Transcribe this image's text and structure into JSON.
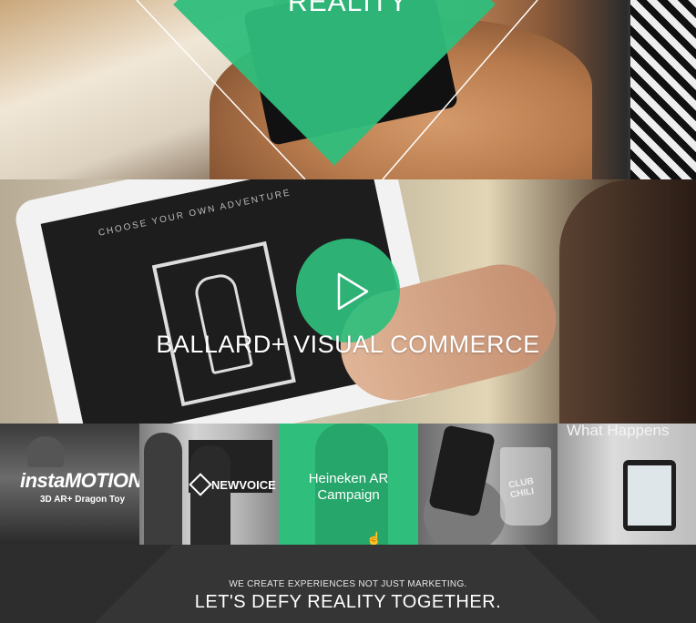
{
  "hero": {
    "title": "REALITY",
    "accent_color": "#2fbe7c"
  },
  "video": {
    "title": "BALLARD+ VISUAL COMMERCE",
    "tablet_heading": "CHOOSE YOUR OWN ADVENTURE",
    "play_icon": "play-icon"
  },
  "thumbnails": [
    {
      "brand": "instaMOTION",
      "subtitle": "3D AR+ Dragon Toy"
    },
    {
      "brand": "NEWVOICE"
    },
    {
      "caption": "Heineken AR Campaign",
      "cursor_icon": "hand-pointer-icon"
    },
    {
      "label": "CLUB CHILI"
    },
    {
      "label": "What Happens"
    }
  ],
  "footer": {
    "tagline": "WE CREATE EXPERIENCES NOT JUST MARKETING.",
    "headline": "LET'S DEFY REALITY TOGETHER."
  }
}
